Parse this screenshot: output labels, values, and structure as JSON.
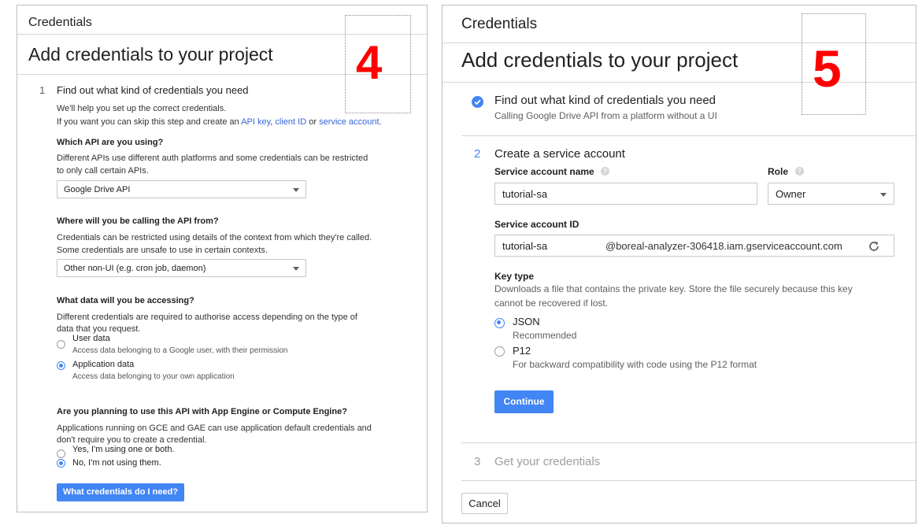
{
  "panel4": {
    "header": "Credentials",
    "page_title": "Add credentials to your project",
    "big_number": "4",
    "step1": {
      "number": "1",
      "title": "Find out what kind of credentials you need",
      "intro_line1": "We'll help you set up the correct credentials.",
      "intro_line2_prefix": "If you want you can skip this step and create an ",
      "link_api_key": "API key",
      "sep1": ", ",
      "link_client_id": "client ID",
      "sep2": " or ",
      "link_service_account": "service account",
      "intro_line2_suffix": "."
    },
    "q1": {
      "title": "Which API are you using?",
      "desc_line1": "Different APIs use different auth platforms and some credentials can be restricted",
      "desc_line2": "to only call certain APIs.",
      "selected": "Google Drive API"
    },
    "q2": {
      "title": "Where will you be calling the API from?",
      "desc_line1": "Credentials can be restricted using details of the context from which they're called.",
      "desc_line2": "Some credentials are unsafe to use in certain contexts.",
      "selected": "Other non-UI (e.g. cron job, daemon)"
    },
    "q3": {
      "title": "What data will you be accessing?",
      "desc_line1": "Different credentials are required to authorise access depending on the type of",
      "desc_line2": "data that you request.",
      "opt1_label": "User data",
      "opt1_desc": "Access data belonging to a Google user, with their permission",
      "opt2_label": "Application data",
      "opt2_desc": "Access data belonging to your own application"
    },
    "q4": {
      "title": "Are you planning to use this API with App Engine or Compute Engine?",
      "desc_line1": "Applications running on GCE and GAE can use application default credentials and",
      "desc_line2": "don't require you to create a credential.",
      "opt1_label": "Yes, I'm using one or both.",
      "opt2_label": "No, I'm not using them."
    },
    "button": "What credentials do I need?"
  },
  "panel5": {
    "header": "Credentials",
    "page_title": "Add credentials to your project",
    "big_number": "5",
    "step1": {
      "title": "Find out what kind of credentials you need",
      "subtitle": "Calling Google Drive API from a platform without a UI"
    },
    "step2": {
      "number": "2",
      "title": "Create a service account",
      "sa_name_label": "Service account name",
      "sa_name_value": "tutorial-sa",
      "role_label": "Role",
      "role_value": "Owner",
      "sa_id_label": "Service account ID",
      "sa_id_value": "tutorial-sa",
      "sa_id_domain": "@boreal-analyzer-306418.iam.gserviceaccount.com",
      "key_type_label": "Key type",
      "key_type_desc_line1": "Downloads a file that contains the private key. Store the file securely because this key",
      "key_type_desc_line2": "cannot be recovered if lost.",
      "json_label": "JSON",
      "json_desc": "Recommended",
      "p12_label": "P12",
      "p12_desc": "For backward compatibility with code using the P12 format",
      "continue": "Continue"
    },
    "step3": {
      "number": "3",
      "title": "Get your credentials"
    },
    "cancel": "Cancel"
  }
}
